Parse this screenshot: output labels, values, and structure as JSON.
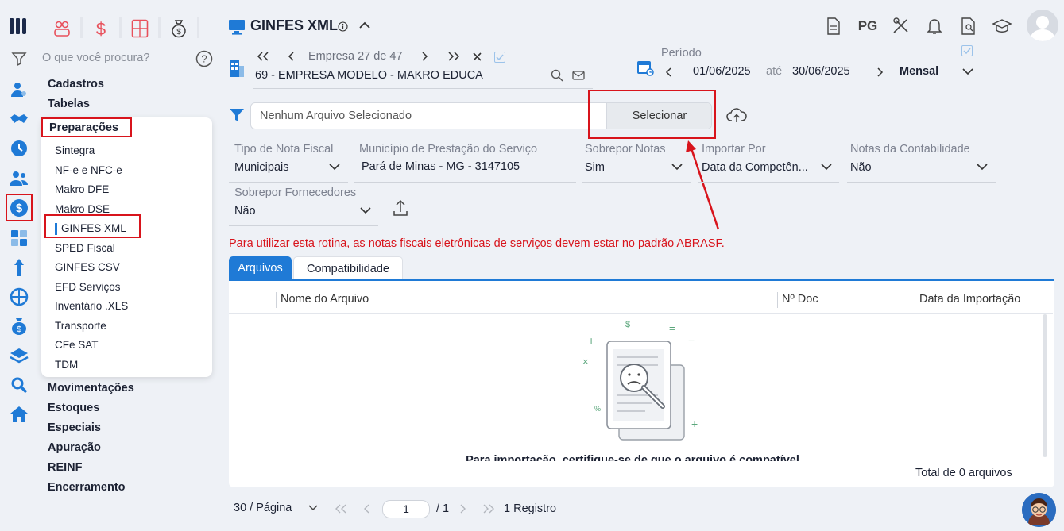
{
  "app": {
    "title": "GINFES XML",
    "info_icon": "info-icon"
  },
  "search": {
    "placeholder": "O que você procura?"
  },
  "menu": {
    "sections_top": [
      "Cadastros",
      "Tabelas"
    ],
    "active_section": "Preparações",
    "sub_items": [
      "Sintegra",
      "NF-e e NFC-e",
      "Makro DFE",
      "Makro DSE",
      "GINFES XML",
      "SPED Fiscal",
      "GINFES CSV",
      "EFD Serviços",
      "Inventário .XLS",
      "Transporte",
      "CFe SAT",
      "TDM"
    ],
    "active_sub_item": "GINFES XML",
    "sections_bottom": [
      "Movimentações",
      "Estoques",
      "Especiais",
      "Apuração",
      "REINF",
      "Encerramento"
    ]
  },
  "toolbar": {
    "pg_label": "PG"
  },
  "empresa": {
    "label": "Empresa",
    "current": "27",
    "of": "de",
    "total": "47",
    "name": "69 - EMPRESA MODELO - MAKRO EDUCA"
  },
  "periodo": {
    "label": "Período",
    "start": "01/06/2025",
    "until": "até",
    "end": "30/06/2025",
    "mode": "Mensal"
  },
  "file": {
    "placeholder": "Nenhum Arquivo Selecionado",
    "select_label": "Selecionar"
  },
  "filters": {
    "tipo_nota": {
      "label": "Tipo de Nota Fiscal",
      "value": "Municipais"
    },
    "municipio": {
      "label": "Município de Prestação do Serviço",
      "value": "Pará de Minas - MG - 3147105"
    },
    "sobrepor_notas": {
      "label": "Sobrepor Notas",
      "value": "Sim"
    },
    "importar_por": {
      "label": "Importar Por",
      "value": "Data da Competên..."
    },
    "notas_contab": {
      "label": "Notas da Contabilidade",
      "value": "Não"
    },
    "sobrepor_fornecedores": {
      "label": "Sobrepor Fornecedores",
      "value": "Não"
    }
  },
  "warning": "Para utilizar esta rotina, as notas fiscais eletrônicas de serviços devem estar no padrão ABRASF.",
  "tabs": [
    "Arquivos",
    "Compatibilidade"
  ],
  "table": {
    "columns": [
      "Nome do Arquivo",
      "Nº Doc",
      "Data da Importação"
    ],
    "empty_text": "Para importação, certifique-se de que o arquivo é compatível."
  },
  "footer": {
    "total": "Total de 0 arquivos",
    "per_page": "30 / Página",
    "page": "1",
    "pages": "/ 1",
    "records": "1 Registro"
  },
  "colors": {
    "accent": "#1f7ad6",
    "warning": "#d8141c",
    "menu_active": "#1f7ad6"
  }
}
